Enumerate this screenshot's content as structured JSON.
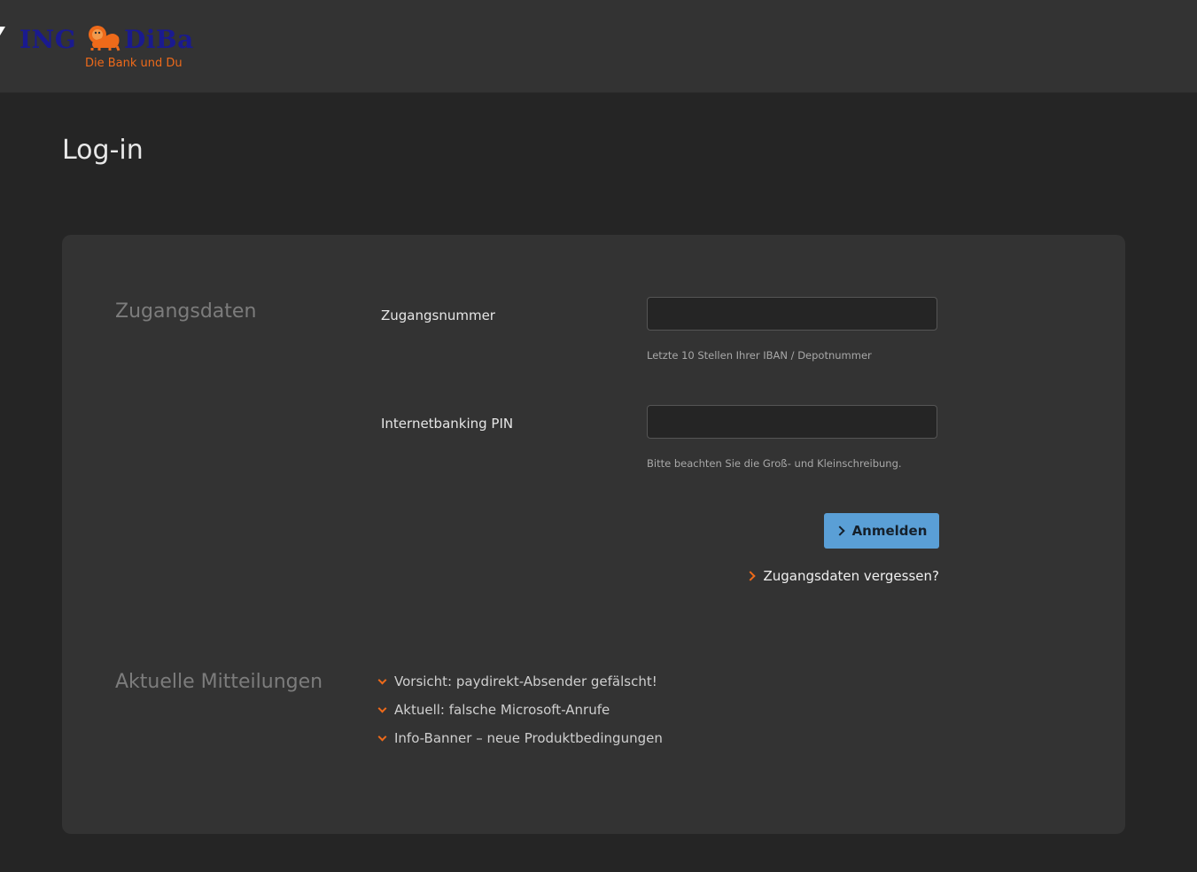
{
  "header": {
    "logo": {
      "brand_left": "ING",
      "brand_right": "DiBa",
      "tagline": "Die Bank und Du"
    }
  },
  "page": {
    "title": "Log-in"
  },
  "login": {
    "section_title": "Zugangsdaten",
    "access_number": {
      "label": "Zugangsnummer",
      "value": "",
      "hint": "Letzte 10 Stellen Ihrer IBAN / Depotnummer"
    },
    "pin": {
      "label": "Internetbanking PIN",
      "value": "",
      "hint": "Bitte beachten Sie die Groß- und Kleinschreibung."
    },
    "submit_label": "Anmelden",
    "forgot_label": "Zugangsdaten vergessen?"
  },
  "news": {
    "section_title": "Aktuelle Mitteilungen",
    "items": [
      {
        "label": "Vorsicht: paydirekt-Absender gefälscht!"
      },
      {
        "label": "Aktuell: falsche Microsoft-Anrufe"
      },
      {
        "label": "Info-Banner – neue Produktbedingungen"
      }
    ]
  },
  "colors": {
    "accent_orange": "#ee6a1a",
    "button_blue": "#5a9fd6",
    "brand_blue": "#1a1a8f",
    "card_bg": "#333333",
    "page_bg": "#252525"
  }
}
